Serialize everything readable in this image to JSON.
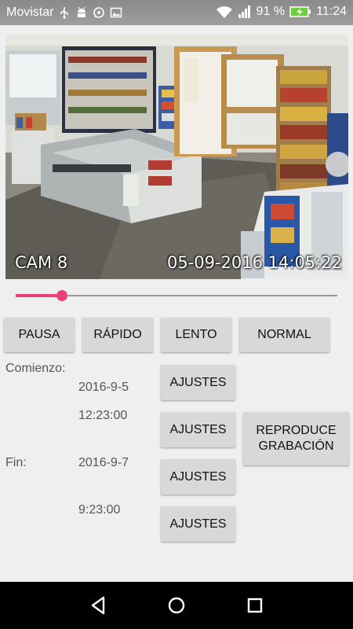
{
  "status_bar": {
    "carrier": "Movistar",
    "battery": "91 %",
    "time": "11:24",
    "icons": [
      "usb-icon",
      "android-icon",
      "whatsapp-icon",
      "image-icon",
      "wifi-icon",
      "signal-icon",
      "battery-charging-icon"
    ]
  },
  "camera": {
    "label": "CAM 8",
    "timestamp": "05-09-2016 14:05:22"
  },
  "seek": {
    "position_fraction": 0.145,
    "color": "#ec407a"
  },
  "speed_buttons": {
    "pause": "PAUSA",
    "fast": "RÁPIDO",
    "slow": "LENTO",
    "normal": "NORMAL"
  },
  "range": {
    "start_label": "Comienzo:",
    "start_date": "2016-9-5",
    "start_time": "12:23:00",
    "end_label": "Fin:",
    "end_date": "2016-9-7",
    "end_time": "9:23:00",
    "adjust_label": "AJUSTES"
  },
  "play_recording": {
    "line1": "REPRODUCE",
    "line2": "GRABACIÓN"
  },
  "nav": [
    "back-icon",
    "home-icon",
    "recents-icon"
  ]
}
